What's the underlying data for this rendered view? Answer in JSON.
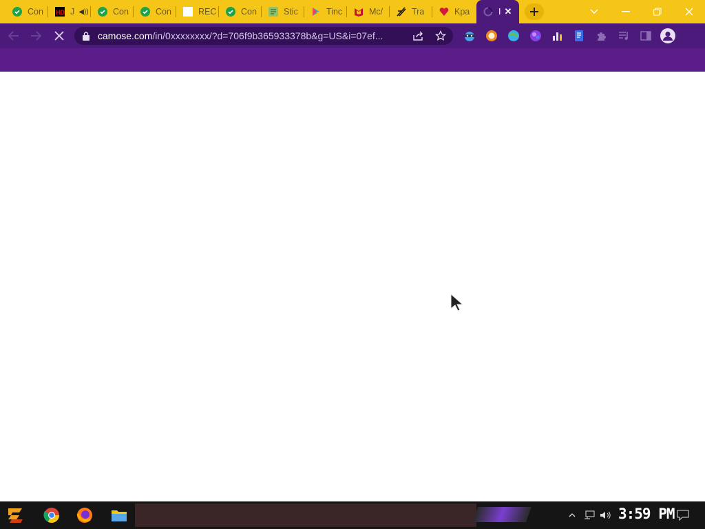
{
  "tabs": [
    {
      "title": "Con",
      "icon": "green-check-icon"
    },
    {
      "title": "J",
      "icon": "hd-icon",
      "audio": true
    },
    {
      "title": "Con",
      "icon": "green-check-icon"
    },
    {
      "title": "Con",
      "icon": "green-check-icon"
    },
    {
      "title": "REC",
      "icon": "blank-page-icon"
    },
    {
      "title": "Con",
      "icon": "green-check-icon"
    },
    {
      "title": "Stic",
      "icon": "sticker-icon"
    },
    {
      "title": "Tinc",
      "icon": "play-store-icon"
    },
    {
      "title": "Mc/",
      "icon": "mcafee-icon"
    },
    {
      "title": "Tra",
      "icon": "tracker-icon"
    },
    {
      "title": "Kpa",
      "icon": "heart-icon"
    },
    {
      "title": "I",
      "icon": "loading-spinner-icon",
      "active": true
    }
  ],
  "omnibox": {
    "host": "camose.com",
    "path": "/in/0xxxxxxxx/?d=706f9b365933378b&g=US&i=07ef..."
  },
  "taskbar": {
    "clock": "3:59 PM"
  },
  "colors": {
    "tab_strip": "#f5c518",
    "toolbar": "#4b1a7a",
    "bookmark_bar": "#5a1d8a",
    "page_bg": "#ffffff"
  }
}
